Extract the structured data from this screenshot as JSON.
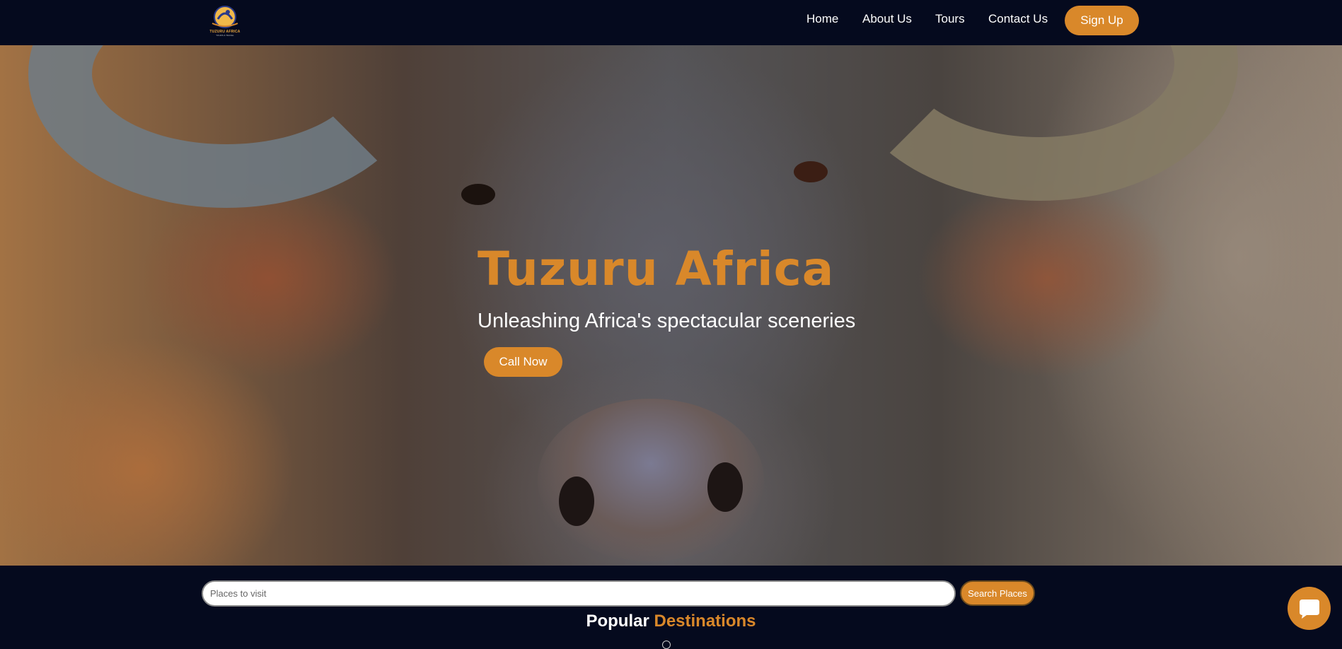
{
  "brand": {
    "logo_text": "TUZURU AFRICA",
    "logo_subtext": "TOURS & TRAVEL"
  },
  "nav": {
    "links": [
      "Home",
      "About Us",
      "Tours",
      "Contact Us"
    ],
    "signup_label": "Sign Up"
  },
  "hero": {
    "title": "Tuzuru Africa",
    "subtitle": "Unleashing Africa's spectacular sceneries",
    "cta_label": "Call Now"
  },
  "search": {
    "placeholder": "Places to visit",
    "value": "",
    "button_label": "Search Places"
  },
  "section": {
    "title_prefix": "Popular",
    "title_accent": "Destinations"
  },
  "chat": {
    "icon": "chat-bubble-icon"
  },
  "colors": {
    "navy": "#050a1e",
    "accent": "#d9882a",
    "text": "#ffffff"
  }
}
